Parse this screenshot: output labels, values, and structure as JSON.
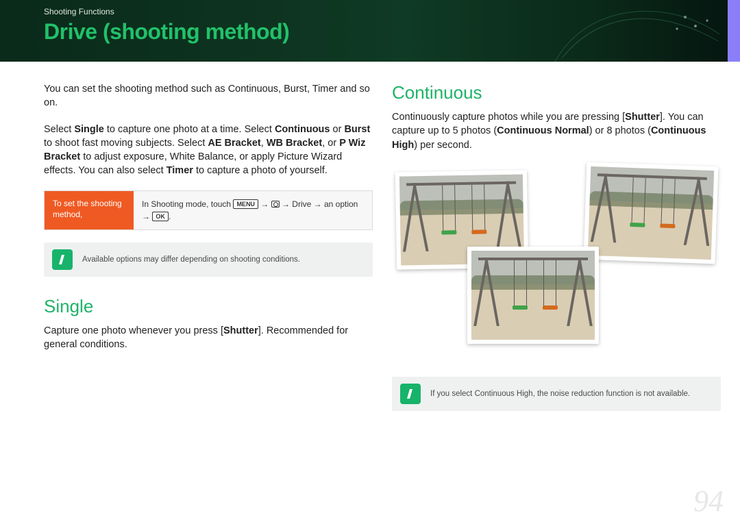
{
  "header": {
    "breadcrumb": "Shooting Functions",
    "title": "Drive (shooting method)"
  },
  "intro": {
    "p1_a": "You can set the shooting method such as Continuous, Burst, Timer and so on.",
    "p2_a": "Select ",
    "p2_b": "Single",
    "p2_c": " to capture one photo at a time. Select ",
    "p2_d": "Continuous",
    "p2_e": " or ",
    "p2_f": "Burst",
    "p2_g": " to shoot fast moving subjects. Select ",
    "p2_h": "AE Bracket",
    "p2_i": ", ",
    "p2_j": "WB Bracket",
    "p2_k": ", or ",
    "p2_l": "P Wiz Bracket",
    "p2_m": " to adjust exposure, White Balance, or apply Picture Wizard effects. You can also select ",
    "p2_n": "Timer",
    "p2_o": " to capture a photo of yourself."
  },
  "instruction": {
    "label": "To set the shooting method,",
    "body_a": "In Shooting mode, touch ",
    "menu": "MENU",
    "arrow": " → ",
    "drive": "Drive",
    "body_b": " → an option → ",
    "ok": "OK",
    "period": "."
  },
  "note1": "Available options may differ depending on shooting conditions.",
  "single": {
    "head": "Single",
    "body_a": "Capture one photo whenever you press [",
    "body_b": "Shutter",
    "body_c": "]. Recommended for general conditions."
  },
  "continuous": {
    "head": "Continuous",
    "body_a": "Continuously capture photos while you are pressing [",
    "body_b": "Shutter",
    "body_c": "]. You can capture up to 5 photos (",
    "body_d": "Continuous Normal",
    "body_e": ") or 8 photos (",
    "body_f": "Continuous High",
    "body_g": ") per second."
  },
  "note2_a": "If you select ",
  "note2_b": "Continuous High",
  "note2_c": ", the noise reduction function is not available.",
  "page_number": "94"
}
